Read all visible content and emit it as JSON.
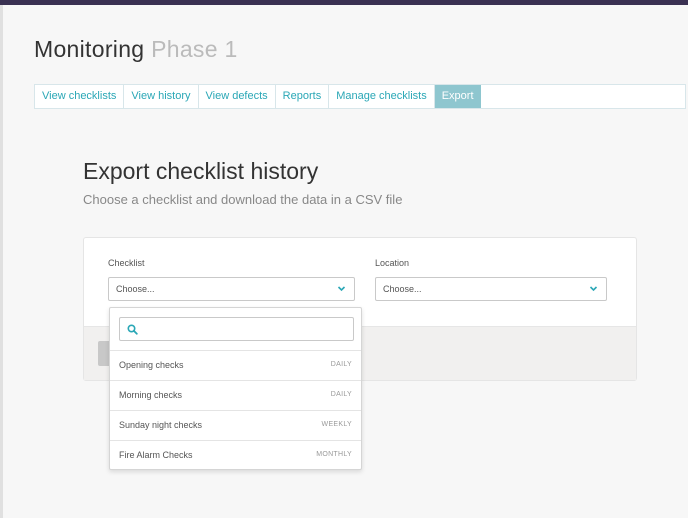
{
  "page": {
    "title": "Monitoring",
    "subtitle": "Phase 1"
  },
  "tabs": [
    {
      "label": "View checklists",
      "active": false
    },
    {
      "label": "View history",
      "active": false
    },
    {
      "label": "View defects",
      "active": false
    },
    {
      "label": "Reports",
      "active": false
    },
    {
      "label": "Manage checklists",
      "active": false
    },
    {
      "label": "Export",
      "active": true
    }
  ],
  "export": {
    "heading": "Export checklist history",
    "subheading": "Choose a checklist and download the data in a CSV file"
  },
  "form": {
    "checklist": {
      "label": "Checklist",
      "value": "Choose..."
    },
    "location": {
      "label": "Location",
      "value": "Choose..."
    }
  },
  "dropdown": {
    "search_value": "",
    "options": [
      {
        "name": "Opening checks",
        "frequency": "DAILY"
      },
      {
        "name": "Morning checks",
        "frequency": "DAILY"
      },
      {
        "name": "Sunday night checks",
        "frequency": "WEEKLY"
      },
      {
        "name": "Fire Alarm Checks",
        "frequency": "MONTHLY"
      }
    ]
  },
  "colors": {
    "accent": "#2aa7b6",
    "active_tab": "#8ec6cf",
    "topbar": "#3a3152"
  },
  "icons": {
    "search": "search-icon",
    "chevron": "chevron-down-icon"
  }
}
